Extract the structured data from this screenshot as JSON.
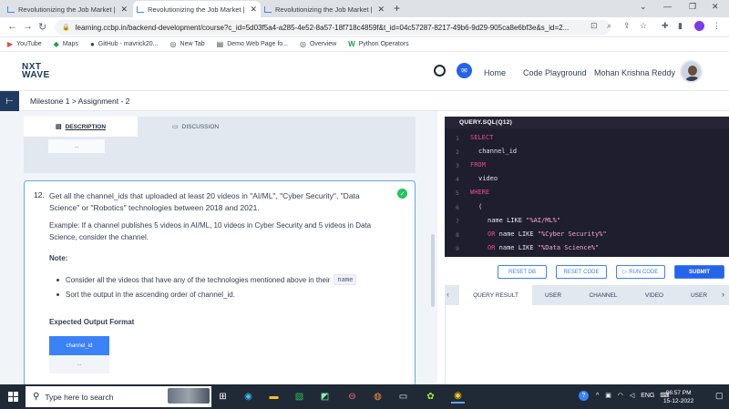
{
  "browser": {
    "tabs": [
      {
        "title": "Revolutionizing the Job Market |",
        "active": false
      },
      {
        "title": "Revolutionizing the Job Market |",
        "active": true
      },
      {
        "title": "Revolutionizing the Job Market |",
        "active": false
      }
    ],
    "url": "learning.ccbp.in/backend-development/course?c_id=5d03f5a4-a285-4e52-8a57-18f718c4859f&t_id=04c57287-8217-49b6-9d29-905ca8e6bf3e&s_id=2...",
    "bookmarks": [
      "YouTube",
      "Maps",
      "GitHub - mavrick20...",
      "New Tab",
      "Demo Web Page fo...",
      "Overview",
      "Python Operators"
    ]
  },
  "header": {
    "logo_line1": "NXT",
    "logo_line2": "WAVE",
    "nav": [
      "Home",
      "Code Playground"
    ],
    "user_name": "Mohan Krishna Reddy"
  },
  "breadcrumb": "Milestone 1 > Assignment - 2",
  "left_tabs": {
    "description": "DESCRIPTION",
    "discussion": "DISCUSSION"
  },
  "prev_cell": "...",
  "question": {
    "number": "12.",
    "text": "Get all the channel_ids that uploaded at least 20 videos in \"AI/ML\", \"Cyber Security\", \"Data Science\" or \"Robotics\" technologies between 2018 and 2021.",
    "example": "Example: If a channel publishes 5 videos in AI/ML, 10 videos in Cyber Security and 5 videos in Data Science, consider the channel.",
    "note_heading": "Note:",
    "note1": "Consider all the videos that have any of the technologies mentioned above in their",
    "note1_code": "name",
    "note2": "Sort the output in the ascending order of channel_id.",
    "expected_heading": "Expected Output Format",
    "expected_column": "channel_id",
    "expected_cell": "..."
  },
  "editor": {
    "title": "QUERY.SQL(Q12)",
    "line_numbers": [
      "1",
      "2",
      "3",
      "4",
      "5",
      "6",
      "7",
      "8",
      "9"
    ],
    "line1": "SELECT",
    "line2": "channel_id",
    "line3": "FROM",
    "line4": "video",
    "line5": "WHERE",
    "line6": "(",
    "line7_id": "name LIKE ",
    "line7_str": "\"%AI/ML%\"",
    "line8_kw": "OR",
    "line8_id": " name LIKE ",
    "line8_str": "\"%Cyber Security%\"",
    "line9_kw": "OR",
    "line9_id": " name LIKE ",
    "line9_str": "\"%Data Science%\""
  },
  "buttons": {
    "reset_db": "RESET DB",
    "reset_code": "RESET CODE",
    "run_code": "RUN CODE",
    "submit": "SUBMIT"
  },
  "result_tabs": [
    "QUERY RESULT",
    "USER",
    "CHANNEL",
    "VIDEO",
    "USER"
  ],
  "taskbar": {
    "search_placeholder": "Type here to search",
    "tray_lang": "ENG",
    "time": "06:57 PM",
    "date": "15-12-2022"
  },
  "colors": {
    "accent": "#2563eb",
    "editor_bg": "#1e1e2e",
    "keyword": "#ec4899",
    "success": "#22c55e"
  }
}
